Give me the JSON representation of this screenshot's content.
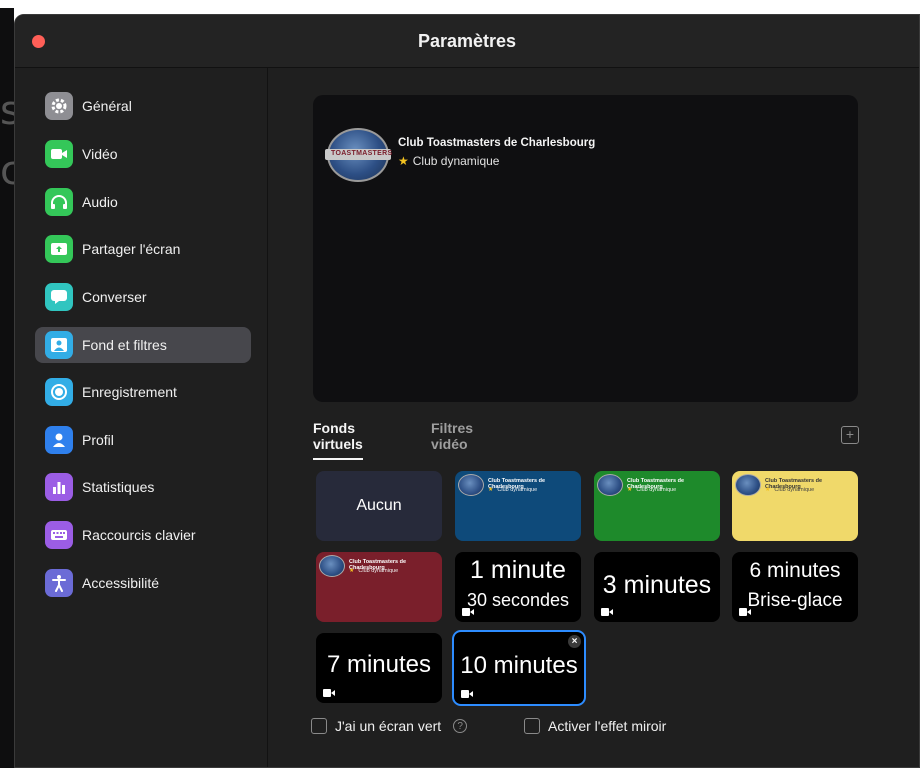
{
  "window": {
    "title": "Paramètres"
  },
  "sidebar": {
    "items": [
      {
        "label": "Général",
        "icon": "gear-icon",
        "color": "#8e8e93"
      },
      {
        "label": "Vidéo",
        "icon": "video-camera-icon",
        "color": "#34c759"
      },
      {
        "label": "Audio",
        "icon": "headphones-icon",
        "color": "#34c759"
      },
      {
        "label": "Partager l'écran",
        "icon": "share-screen-icon",
        "color": "#34c759"
      },
      {
        "label": "Converser",
        "icon": "chat-bubble-icon",
        "color": "#30c5c0"
      },
      {
        "label": "Fond et filtres",
        "icon": "background-person-icon",
        "color": "#32ade6",
        "active": true
      },
      {
        "label": "Enregistrement",
        "icon": "record-icon",
        "color": "#32ade6"
      },
      {
        "label": "Profil",
        "icon": "person-icon",
        "color": "#2f80ed"
      },
      {
        "label": "Statistiques",
        "icon": "bar-chart-icon",
        "color": "#9b5de5"
      },
      {
        "label": "Raccourcis clavier",
        "icon": "keyboard-icon",
        "color": "#9b5de5"
      },
      {
        "label": "Accessibilité",
        "icon": "accessibility-icon",
        "color": "#6b6bd6"
      }
    ]
  },
  "preview": {
    "logo_text": "TOASTMASTERS",
    "club_name": "Club Toastmasters de Charlesbourg",
    "club_sub": "Club dynamique"
  },
  "tabs": {
    "virtual": "Fonds virtuels",
    "filters": "Filtres vidéo"
  },
  "tiles": {
    "none": "Aucun",
    "mini_name": "Club Toastmasters de Charlesbourg",
    "mini_sub": "Club dynamique",
    "colors": {
      "blue": "#0e4a7a",
      "green": "#1e8a2b",
      "yellow": "#f0d96a",
      "red": "#7a1f2b"
    },
    "one_minute_l1": "1 minute",
    "one_minute_l2": "30 secondes",
    "three_minutes": "3 minutes",
    "six_minutes_l1": "6 minutes",
    "six_minutes_l2": "Brise-glace",
    "seven_minutes": "7 minutes",
    "ten_minutes": "10 minutes"
  },
  "options": {
    "green_screen": "J'ai un écran vert",
    "mirror": "Activer l'effet miroir"
  }
}
